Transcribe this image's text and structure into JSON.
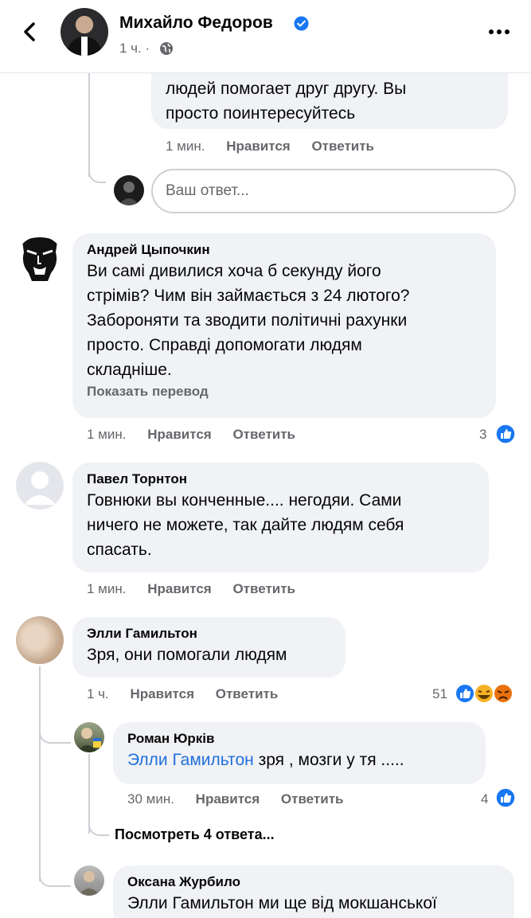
{
  "header": {
    "name": "Михайло Федоров",
    "time": "1 ч. ·",
    "icons": [
      "back-arrow-icon",
      "verified-badge-icon",
      "globe-icon",
      "more-icon"
    ]
  },
  "prev_comment": {
    "text_line1": "людей помогает друг другу. Вы",
    "text_line2": "просто поинтересуйтесь",
    "time": "1 мин.",
    "like": "Нравится",
    "reply": "Ответить"
  },
  "reply_box": {
    "placeholder": "Ваш ответ..."
  },
  "comments": [
    {
      "author": "Андрей Цыпочкин",
      "lines": [
        "Ви самі дивилися хоча б секунду його",
        "стрімів? Чим він займається з 24 лютого?",
        "Забороняти та зводити політичні рахунки",
        "просто. Справді допомогати людям",
        "складніше."
      ],
      "translate": "Показать перевод",
      "time": "1 мин.",
      "like": "Нравится",
      "reply": "Ответить",
      "reactions": "3"
    },
    {
      "author": "Павел Торнтон",
      "lines": [
        "Говнюки вы конченные.... негодяи. Сами",
        "ничего не можете, так дайте людям себя",
        "спасать."
      ],
      "time": "1 мин.",
      "like": "Нравится",
      "reply": "Ответить"
    },
    {
      "author": "Элли Гамильтон",
      "lines": [
        "Зря, они помогали людям"
      ],
      "time": "1 ч.",
      "like": "Нравится",
      "reply": "Ответить",
      "reactions": "51"
    }
  ],
  "replies": [
    {
      "author": "Роман Юрків",
      "mention": "Элли Гамильтон",
      "text": " зря , мозги  у тя  .....",
      "time": "30 мин.",
      "like": "Нравится",
      "reply": "Ответить",
      "reactions": "4"
    },
    {
      "author": "Оксана Журбило",
      "mention": "Элли Гамильтон",
      "text": " ми ще від мокшанської"
    }
  ],
  "view_replies": "Посмотреть 4 ответа..."
}
